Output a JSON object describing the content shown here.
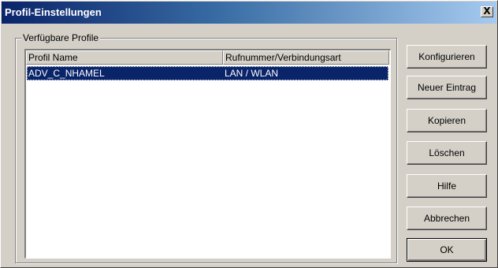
{
  "window": {
    "title": "Profil-Einstellungen",
    "close_label": "X"
  },
  "group": {
    "label": "Verfügbare Profile"
  },
  "list": {
    "columns": [
      "Profil Name",
      "Rufnummer/Verbindungsart"
    ],
    "rows": [
      {
        "name": "ADV_C_NHAMEL",
        "connection": "LAN / WLAN",
        "selected": true
      }
    ]
  },
  "buttons": {
    "konfigurieren": "Konfigurieren",
    "neuer_eintrag": "Neuer Eintrag",
    "kopieren": "Kopieren",
    "loeschen": "Löschen",
    "hilfe": "Hilfe",
    "abbrechen": "Abbrechen",
    "ok": "OK"
  }
}
